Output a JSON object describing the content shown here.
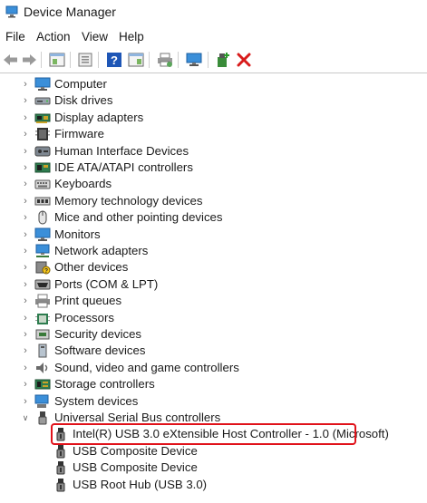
{
  "window": {
    "title": "Device Manager",
    "icon": "device-manager-icon"
  },
  "menu": [
    "File",
    "Action",
    "View",
    "Help"
  ],
  "toolbar": [
    {
      "name": "back-arrow-icon"
    },
    {
      "name": "forward-arrow-icon"
    },
    {
      "name": "properties-icon"
    },
    {
      "name": "update-driver-icon"
    },
    {
      "name": "help-icon"
    },
    {
      "name": "show-hidden-icon"
    },
    {
      "name": "print-icon"
    },
    {
      "name": "scan-hardware-icon"
    },
    {
      "name": "add-driver-icon"
    },
    {
      "name": "uninstall-device-icon"
    }
  ],
  "categories": [
    {
      "label": "Computer",
      "icon": "computer-icon"
    },
    {
      "label": "Disk drives",
      "icon": "disk-drive-icon"
    },
    {
      "label": "Display adapters",
      "icon": "display-adapter-icon"
    },
    {
      "label": "Firmware",
      "icon": "firmware-icon"
    },
    {
      "label": "Human Interface Devices",
      "icon": "hid-icon"
    },
    {
      "label": "IDE ATA/ATAPI controllers",
      "icon": "ide-controller-icon"
    },
    {
      "label": "Keyboards",
      "icon": "keyboard-icon"
    },
    {
      "label": "Memory technology devices",
      "icon": "memory-icon"
    },
    {
      "label": "Mice and other pointing devices",
      "icon": "mouse-icon"
    },
    {
      "label": "Monitors",
      "icon": "monitor-icon"
    },
    {
      "label": "Network adapters",
      "icon": "network-adapter-icon"
    },
    {
      "label": "Other devices",
      "icon": "other-devices-icon"
    },
    {
      "label": "Ports (COM & LPT)",
      "icon": "ports-icon"
    },
    {
      "label": "Print queues",
      "icon": "printer-icon"
    },
    {
      "label": "Processors",
      "icon": "processor-icon"
    },
    {
      "label": "Security devices",
      "icon": "security-icon"
    },
    {
      "label": "Software devices",
      "icon": "software-device-icon"
    },
    {
      "label": "Sound, video and game controllers",
      "icon": "sound-icon"
    },
    {
      "label": "Storage controllers",
      "icon": "storage-controller-icon"
    },
    {
      "label": "System devices",
      "icon": "system-devices-icon"
    },
    {
      "label": "Universal Serial Bus controllers",
      "icon": "usb-icon",
      "expanded": true
    }
  ],
  "usb_children": [
    {
      "label": "Intel(R) USB 3.0 eXtensible Host Controller - 1.0 (Microsoft)",
      "icon": "usb-plug-icon",
      "highlighted": true
    },
    {
      "label": "USB Composite Device",
      "icon": "usb-plug-icon"
    },
    {
      "label": "USB Composite Device",
      "icon": "usb-plug-icon"
    },
    {
      "label": "USB Root Hub (USB 3.0)",
      "icon": "usb-plug-icon"
    }
  ],
  "colors": {
    "highlight_border": "#e0121a",
    "uninstall_red": "#d81b1b",
    "help_blue": "#1e56b6"
  }
}
